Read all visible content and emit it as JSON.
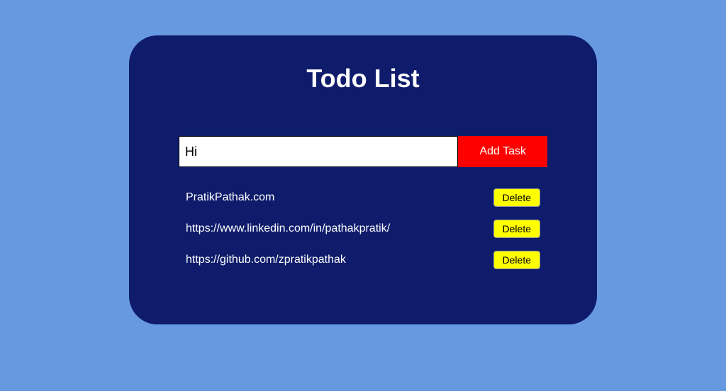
{
  "title": "Todo List",
  "input": {
    "value": "Hi",
    "placeholder": ""
  },
  "addButton": "Add Task",
  "deleteLabel": "Delete",
  "tasks": [
    "PratikPathak.com",
    "https://www.linkedin.com/in/pathakpratik/",
    "https://github.com/zpratikpathak"
  ]
}
